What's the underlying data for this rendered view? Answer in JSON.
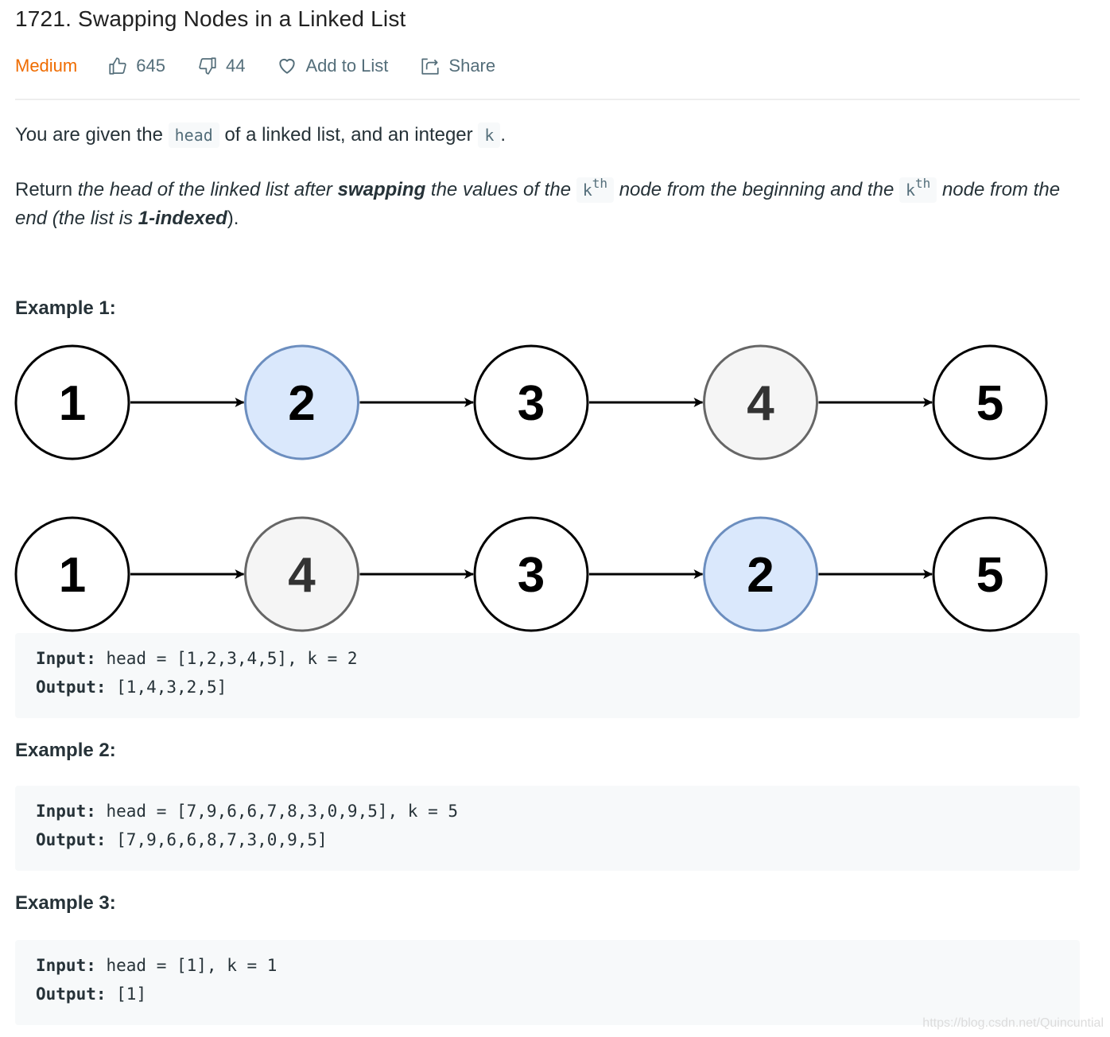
{
  "problem": {
    "title": "1721. Swapping Nodes in a Linked List",
    "difficulty": "Medium",
    "likes": "645",
    "dislikes": "44",
    "add_to_list_label": "Add to List",
    "share_label": "Share"
  },
  "description": {
    "p1": {
      "t1": "You are given the ",
      "code1": "head",
      "t2": " of a linked list, and an integer ",
      "code2": "k",
      "t3": "."
    },
    "p2": {
      "t1": "Return ",
      "em1": "the head of the linked list after ",
      "strong1": "swapping",
      "em2": " the values of the ",
      "code1": "k",
      "sup1": "th",
      "em3": " node from the beginning and the ",
      "code2": "k",
      "sup2": "th",
      "em4": " node from the end (the list is ",
      "strong2": "1-indexed",
      "t2": ")."
    }
  },
  "examples": [
    {
      "heading": "Example 1:",
      "diagram": {
        "before": [
          {
            "value": "1",
            "style": "plain"
          },
          {
            "value": "2",
            "style": "blue"
          },
          {
            "value": "3",
            "style": "plain"
          },
          {
            "value": "4",
            "style": "gray"
          },
          {
            "value": "5",
            "style": "plain"
          }
        ],
        "after": [
          {
            "value": "1",
            "style": "plain"
          },
          {
            "value": "4",
            "style": "gray"
          },
          {
            "value": "3",
            "style": "plain"
          },
          {
            "value": "2",
            "style": "blue"
          },
          {
            "value": "5",
            "style": "plain"
          }
        ]
      },
      "input_label": "Input:",
      "input_value": " head = [1,2,3,4,5], k = 2",
      "output_label": "Output:",
      "output_value": " [1,4,3,2,5]"
    },
    {
      "heading": "Example 2:",
      "input_label": "Input:",
      "input_value": " head = [7,9,6,6,7,8,3,0,9,5], k = 5",
      "output_label": "Output:",
      "output_value": " [7,9,6,6,8,7,3,0,9,5]"
    },
    {
      "heading": "Example 3:",
      "input_label": "Input:",
      "input_value": " head = [1], k = 1",
      "output_label": "Output:",
      "output_value": " [1]"
    }
  ],
  "node_colors": {
    "plain": {
      "fill": "#ffffff",
      "stroke": "#000000",
      "text": "#000000"
    },
    "blue": {
      "fill": "#dae8fc",
      "stroke": "#6c8ebf",
      "text": "#000000"
    },
    "gray": {
      "fill": "#f5f5f5",
      "stroke": "#666666",
      "text": "#333333"
    }
  },
  "watermark": "https://blog.csdn.net/Quincuntial"
}
